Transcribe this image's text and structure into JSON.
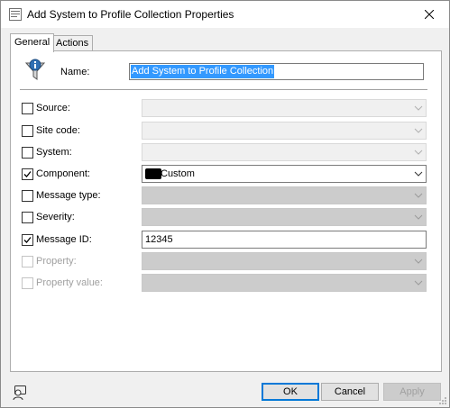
{
  "window": {
    "title": "Add System to Profile Collection Properties"
  },
  "tabs": [
    {
      "label": "General",
      "active": true
    },
    {
      "label": "Actions",
      "active": false
    }
  ],
  "name": {
    "label": "Name:",
    "value": "Add System to Profile Collection"
  },
  "filters": [
    {
      "label": "Source:",
      "checked": false,
      "enabled": true,
      "type": "dropdown",
      "value": ""
    },
    {
      "label": "Site code:",
      "checked": false,
      "enabled": true,
      "type": "dropdown",
      "value": ""
    },
    {
      "label": "System:",
      "checked": false,
      "enabled": true,
      "type": "dropdown",
      "value": ""
    },
    {
      "label": "Component:",
      "checked": true,
      "enabled": true,
      "type": "dropdown",
      "value": "Custom"
    },
    {
      "label": "Message type:",
      "checked": false,
      "enabled": true,
      "type": "dropdown",
      "value": ""
    },
    {
      "label": "Severity:",
      "checked": false,
      "enabled": true,
      "type": "dropdown",
      "value": ""
    },
    {
      "label": "Message ID:",
      "checked": true,
      "enabled": true,
      "type": "text",
      "value": "12345"
    },
    {
      "label": "Property:",
      "checked": false,
      "enabled": false,
      "type": "dropdown",
      "value": ""
    },
    {
      "label": "Property value:",
      "checked": false,
      "enabled": false,
      "type": "dropdown",
      "value": ""
    }
  ],
  "buttons": {
    "ok": "OK",
    "cancel": "Cancel",
    "apply": "Apply"
  },
  "icons": {
    "app": "properties-icon",
    "name": "filter-info-icon",
    "status": "user-search-icon",
    "close": "close-icon"
  }
}
